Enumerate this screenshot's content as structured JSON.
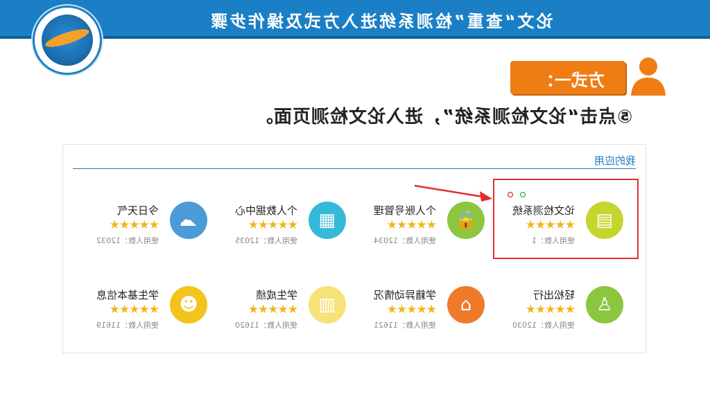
{
  "header": {
    "title": "论文“查重”检测系统进入方式及操作步骤"
  },
  "badge": {
    "label": "方式一："
  },
  "instruction": {
    "text": "⑤点击“论文检测系统”，进入论文检测页面。"
  },
  "panel": {
    "section_title": "我的应用",
    "apps": [
      {
        "name": "论文检测系统",
        "users": "使用人数：1",
        "rating": "★★★★★",
        "color": "#c4d62d",
        "icon": "document-icon",
        "glyph": "▤"
      },
      {
        "name": "个人账号管理",
        "users": "使用人数：12034",
        "rating": "★★★★★",
        "color": "#8cc63f",
        "icon": "lock-icon",
        "glyph": "🔒"
      },
      {
        "name": "个人数据中心",
        "users": "使用人数：12035",
        "rating": "★★★★★",
        "color": "#36b8d8",
        "icon": "data-icon",
        "glyph": "▦"
      },
      {
        "name": "今日天气",
        "users": "使用人数：12032",
        "rating": "★★★★★",
        "color": "#4a9bd8",
        "icon": "weather-icon",
        "glyph": "☁"
      },
      {
        "name": "轻松出行",
        "users": "使用人数：12030",
        "rating": "★★★★★",
        "color": "#8cc63f",
        "icon": "walker-icon",
        "glyph": "♙"
      },
      {
        "name": "学籍异动情况",
        "users": "使用人数：11621",
        "rating": "★★★★★",
        "color": "#ee7a2b",
        "icon": "inbox-icon",
        "glyph": "⌂"
      },
      {
        "name": "学生成绩",
        "users": "使用人数：11620",
        "rating": "★★★★★",
        "color": "#f6e27a",
        "icon": "grades-icon",
        "glyph": "▥"
      },
      {
        "name": "学生基本信息",
        "users": "使用人数：11619",
        "rating": "★★★★★",
        "color": "#f2c41c",
        "icon": "person-icon",
        "glyph": "☻"
      }
    ]
  }
}
